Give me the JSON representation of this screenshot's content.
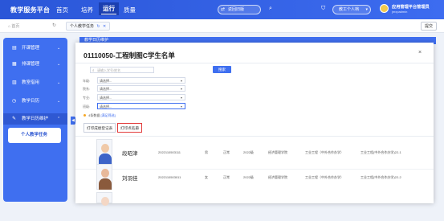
{
  "topbar": {
    "brand": "教学服务平台",
    "nav": [
      "首页",
      "培养",
      "运行",
      "质量"
    ],
    "active_nav": "运行",
    "switch_label": "返回旧版",
    "personal_center": "教工个人档",
    "user_name": "应用管理平台管理员",
    "user_sub": "jmxpadmin"
  },
  "tabsbar": {
    "home": "首页",
    "current_tab": "个人教学任务",
    "submit": "提交"
  },
  "sidebar": {
    "items": [
      {
        "label": "开课管理",
        "icon": "book-icon"
      },
      {
        "label": "排课管理",
        "icon": "calendar-icon"
      },
      {
        "label": "教室借用",
        "icon": "building-icon"
      },
      {
        "label": "教学日历",
        "icon": "clock-icon"
      },
      {
        "label": "教学日历维护",
        "icon": "edit-icon"
      }
    ],
    "sub_item": "个人教学任务"
  },
  "background": {
    "title": "教学日历维护"
  },
  "modal": {
    "title": "01110050-工程制图C学生名单",
    "search_placeholder": "请输入学号/姓名",
    "search_button": "搜索",
    "filters": [
      {
        "label": "年级:",
        "value": "请选择..."
      },
      {
        "label": "院系:",
        "value": "请选择..."
      },
      {
        "label": "专业:",
        "value": "请选择..."
      },
      {
        "label": "班级:",
        "value": "请选择..."
      }
    ],
    "result_text": "4条数据",
    "result_link": "[满足筛选]",
    "print_list_label": "打印成绩登记表",
    "print_name_label": "打印点名册",
    "students": [
      {
        "name": "段昭津",
        "id": "2022110503111",
        "gender": "男",
        "status": "正常",
        "grade": "2022级",
        "college": "经济管理学院",
        "major": "工业工程（中外合作办学）",
        "class": "工业工程(中外合作办学)22-1"
      },
      {
        "name": "刘羽佳",
        "id": "2022110503011",
        "gender": "女",
        "status": "正常",
        "grade": "2022级",
        "college": "经济管理学院",
        "major": "工业工程（中外合作办学）",
        "class": "工业工程(中外合作办学)22-2"
      }
    ]
  },
  "colors": {
    "primary": "#3f6ff0",
    "highlight_border": "#e23a3a"
  }
}
